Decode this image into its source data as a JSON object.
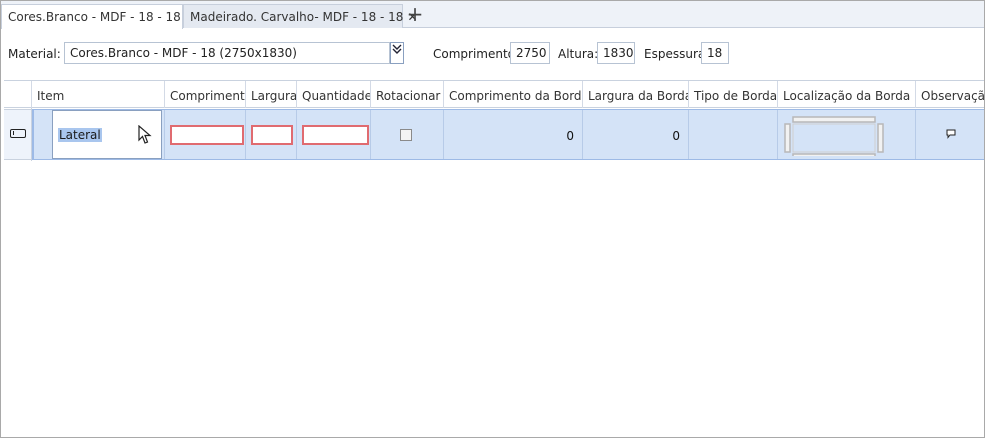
{
  "tabs": [
    {
      "label": "Cores.Branco - MDF - 18 - 18",
      "active": true
    },
    {
      "label": "Madeirado. Carvalho- MDF - 18 - 18",
      "active": false
    }
  ],
  "material": {
    "label": "Material:",
    "value": "Cores.Branco - MDF - 18 (2750x1830)",
    "comprimento_label": "Comprimento:",
    "comprimento_value": "2750",
    "altura_label": "Altura:",
    "altura_value": "1830",
    "espessura_label": "Espessura:",
    "espessura_value": "18"
  },
  "grid": {
    "columns": [
      "Item",
      "Comprimento",
      "Largura",
      "Quantidade",
      "Rotacionar",
      "Comprimento da Borda",
      "Largura da Borda",
      "Tipo de Borda",
      "Localização da Borda",
      "Observação"
    ],
    "rows": [
      {
        "item": "Lateral",
        "comprimento": "",
        "largura": "",
        "quantidade": "",
        "rotacionar": false,
        "comprimento_borda": "0",
        "largura_borda": "0",
        "tipo_borda": ""
      }
    ]
  },
  "icons": {
    "close": "close-icon",
    "add_tab": "plus-icon",
    "dropdown": "double-chevron-down-icon",
    "row_indicator": "row-edit-icon",
    "note": "comment-icon"
  }
}
